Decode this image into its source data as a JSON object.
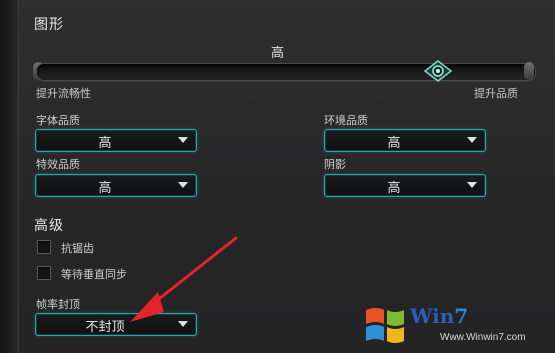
{
  "graphics": {
    "title": "图形",
    "overall_quality": "高",
    "slider": {
      "left_label": "提升流畅性",
      "right_label": "提升品质",
      "level": 0.81
    }
  },
  "settings": {
    "font_quality": {
      "label": "字体品质",
      "value": "高"
    },
    "environment_quality": {
      "label": "环境品质",
      "value": "高"
    },
    "effects_quality": {
      "label": "特效品质",
      "value": "高"
    },
    "shadows": {
      "label": "阴影",
      "value": "高"
    }
  },
  "advanced": {
    "title": "高级",
    "antialiasing": {
      "label": "抗锯齿",
      "checked": false
    },
    "vsync": {
      "label": "等待垂直同步",
      "checked": false
    },
    "frame_cap": {
      "label": "帧率封顶",
      "value": "不封顶"
    }
  },
  "watermark": {
    "brand_prefix": "Win",
    "brand_suffix": "7",
    "url": "Www.Winwin7.com"
  },
  "colors": {
    "accent": "#2fa6a6",
    "annotation_arrow": "#e3242b"
  }
}
